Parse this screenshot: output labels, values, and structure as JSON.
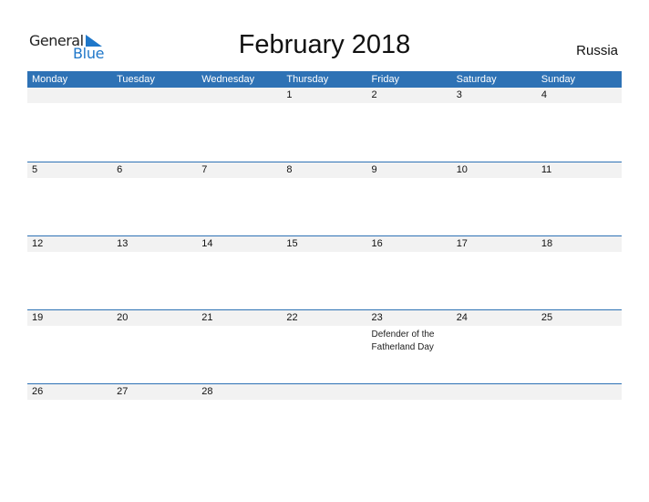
{
  "logo": {
    "line1": "General",
    "line2": "Blue",
    "icon": "triangle-flag-icon"
  },
  "title": "February 2018",
  "country": "Russia",
  "colors": {
    "accent": "#2e72b5",
    "brand_blue": "#1f77c9",
    "strip": "#f2f2f2"
  },
  "weekdays": [
    "Monday",
    "Tuesday",
    "Wednesday",
    "Thursday",
    "Friday",
    "Saturday",
    "Sunday"
  ],
  "weeks": [
    {
      "days": [
        "",
        "",
        "",
        "1",
        "2",
        "3",
        "4"
      ],
      "events": [
        "",
        "",
        "",
        "",
        "",
        "",
        ""
      ]
    },
    {
      "days": [
        "5",
        "6",
        "7",
        "8",
        "9",
        "10",
        "11"
      ],
      "events": [
        "",
        "",
        "",
        "",
        "",
        "",
        ""
      ]
    },
    {
      "days": [
        "12",
        "13",
        "14",
        "15",
        "16",
        "17",
        "18"
      ],
      "events": [
        "",
        "",
        "",
        "",
        "",
        "",
        ""
      ]
    },
    {
      "days": [
        "19",
        "20",
        "21",
        "22",
        "23",
        "24",
        "25"
      ],
      "events": [
        "",
        "",
        "",
        "",
        "Defender of the Fatherland Day",
        "",
        ""
      ]
    },
    {
      "days": [
        "26",
        "27",
        "28",
        "",
        "",
        "",
        ""
      ],
      "events": [
        "",
        "",
        "",
        "",
        "",
        "",
        ""
      ]
    }
  ]
}
